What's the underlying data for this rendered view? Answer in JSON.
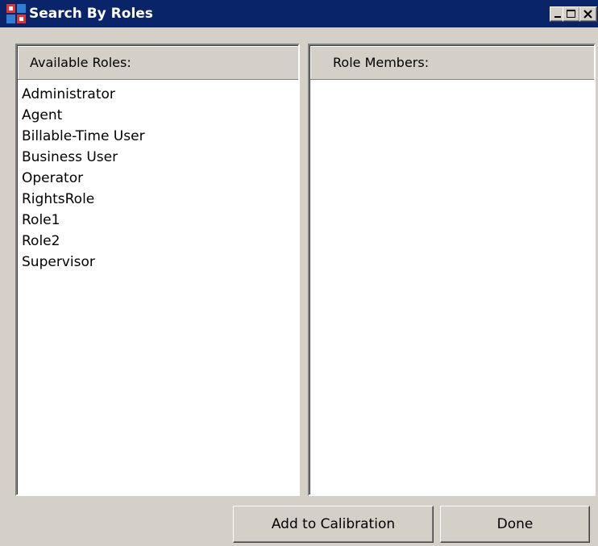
{
  "window": {
    "title": "Search By Roles",
    "icon": "search-roles-app-icon",
    "controls": [
      "minimize-icon",
      "maximize-icon",
      "close-icon"
    ],
    "titlebar_color": "#0a246a"
  },
  "available_roles": {
    "header": "Available Roles:",
    "items": [
      "Administrator",
      "Agent",
      "Billable-Time User",
      "Business User",
      "Operator",
      "RightsRole",
      "Role1",
      "Role2",
      "Supervisor"
    ]
  },
  "role_members": {
    "header": "Role Members:",
    "items": []
  },
  "buttons": {
    "add_to_calibration": "Add to Calibration",
    "done": "Done"
  }
}
